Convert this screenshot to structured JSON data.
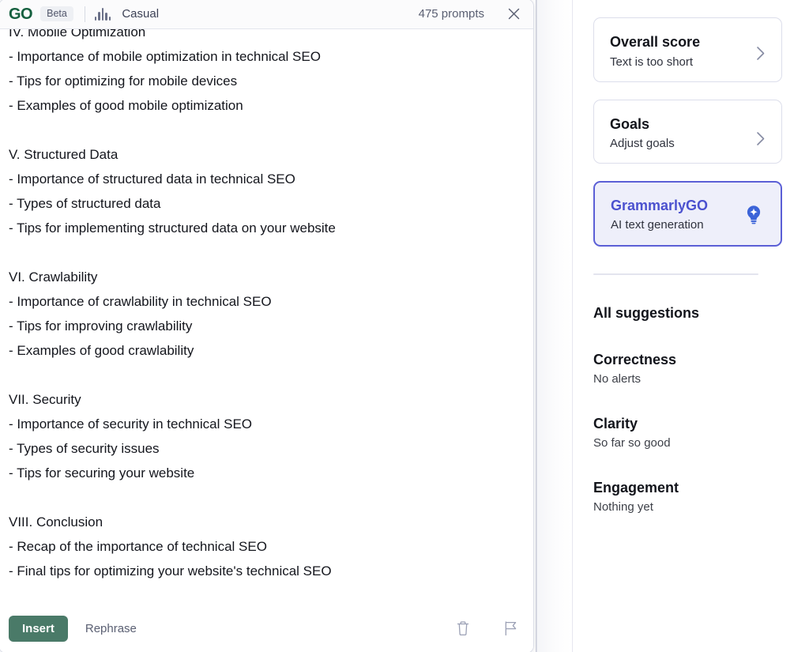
{
  "go_panel": {
    "header": {
      "logo": "GO",
      "beta_badge": "Beta",
      "tone_icon": "waveform-icon",
      "tone_label": "Casual",
      "prompt_count": "475 prompts",
      "close_icon": "close-icon"
    },
    "generated_text": "IV. Mobile Optimization\n- Importance of mobile optimization in technical SEO\n- Tips for optimizing for mobile devices\n- Examples of good mobile optimization\n\nV. Structured Data\n- Importance of structured data in technical SEO\n- Types of structured data\n- Tips for implementing structured data on your website\n\nVI. Crawlability\n- Importance of crawlability in technical SEO\n- Tips for improving crawlability\n- Examples of good crawlability\n\nVII. Security\n- Importance of security in technical SEO\n- Types of security issues\n- Tips for securing your website\n\nVIII. Conclusion\n- Recap of the importance of technical SEO\n- Final tips for optimizing your website's technical SEO",
    "footer": {
      "insert_label": "Insert",
      "rephrase_label": "Rephrase",
      "delete_icon": "trash-icon",
      "flag_icon": "flag-icon"
    }
  },
  "sidebar": {
    "overall_score": {
      "title": "Overall score",
      "subtitle": "Text is too short",
      "chevron_icon": "chevron-right-icon"
    },
    "goals": {
      "title": "Goals",
      "subtitle": "Adjust goals",
      "chevron_icon": "chevron-right-icon"
    },
    "grammarly_go": {
      "title": "GrammarlyGO",
      "subtitle": "AI text generation",
      "icon": "lightbulb-sparkle-icon"
    },
    "all_suggestions_label": "All suggestions",
    "suggestions": [
      {
        "name": "Correctness",
        "status": "No alerts"
      },
      {
        "name": "Clarity",
        "status": "So far so good"
      },
      {
        "name": "Engagement",
        "status": "Nothing yet"
      }
    ]
  },
  "colors": {
    "brand_green": "#15603f",
    "insert_green": "#4a7a68",
    "go_purple": "#4b51cf",
    "go_border": "#5b5fd6",
    "go_bg": "#eeeffa",
    "bulb_blue": "#3b63d8"
  }
}
